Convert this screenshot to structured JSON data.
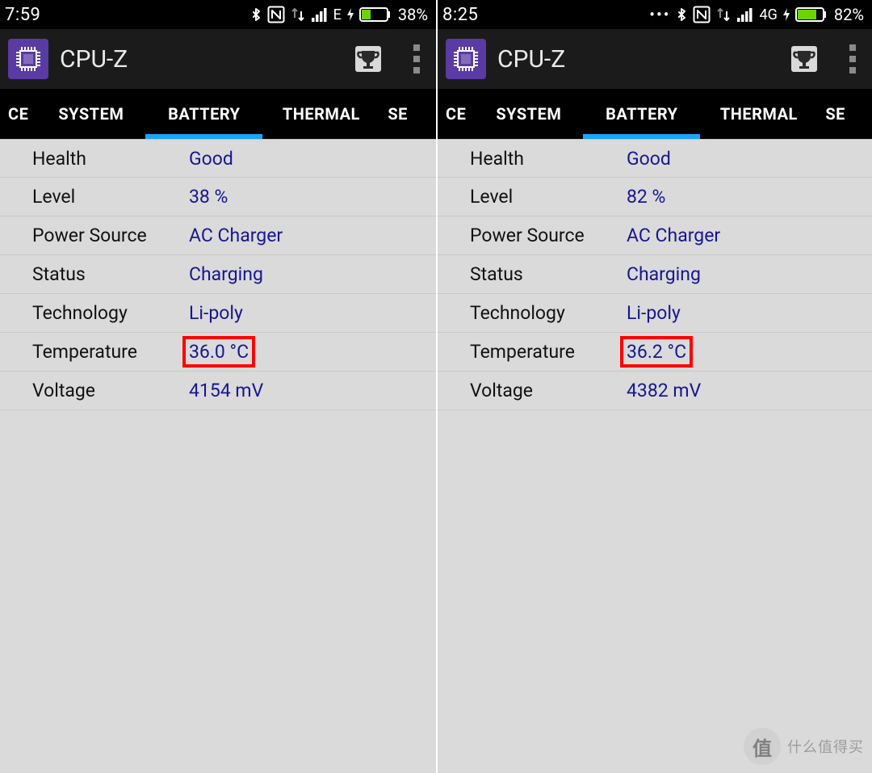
{
  "screens": [
    {
      "status": {
        "time": "7:59",
        "show_dots": false,
        "network_label": "E",
        "battery_pct": "38%",
        "battery_fill": 0.38
      },
      "appbar": {
        "title": "CPU-Z"
      },
      "tabs": {
        "left_edge": "CE",
        "items": [
          "SYSTEM",
          "BATTERY",
          "THERMAL"
        ],
        "right_edge": "SE",
        "active_index": 1
      },
      "rows": [
        {
          "label": "Health",
          "value": "Good",
          "highlight": false
        },
        {
          "label": "Level",
          "value": "38 %",
          "highlight": false
        },
        {
          "label": "Power Source",
          "value": "AC Charger",
          "highlight": false
        },
        {
          "label": "Status",
          "value": "Charging",
          "highlight": false
        },
        {
          "label": "Technology",
          "value": "Li-poly",
          "highlight": false
        },
        {
          "label": "Temperature",
          "value": "36.0 °C",
          "highlight": true
        },
        {
          "label": "Voltage",
          "value": "4154 mV",
          "highlight": false
        }
      ]
    },
    {
      "status": {
        "time": "8:25",
        "show_dots": true,
        "network_label": "4G",
        "battery_pct": "82%",
        "battery_fill": 0.82
      },
      "appbar": {
        "title": "CPU-Z"
      },
      "tabs": {
        "left_edge": "CE",
        "items": [
          "SYSTEM",
          "BATTERY",
          "THERMAL"
        ],
        "right_edge": "SE",
        "active_index": 1
      },
      "rows": [
        {
          "label": "Health",
          "value": "Good",
          "highlight": false
        },
        {
          "label": "Level",
          "value": "82 %",
          "highlight": false
        },
        {
          "label": "Power Source",
          "value": "AC Charger",
          "highlight": false
        },
        {
          "label": "Status",
          "value": "Charging",
          "highlight": false
        },
        {
          "label": "Technology",
          "value": "Li-poly",
          "highlight": false
        },
        {
          "label": "Temperature",
          "value": "36.2 °C",
          "highlight": true
        },
        {
          "label": "Voltage",
          "value": "4382 mV",
          "highlight": false
        }
      ]
    }
  ],
  "watermark": {
    "badge": "值",
    "text": "什么值得买"
  }
}
